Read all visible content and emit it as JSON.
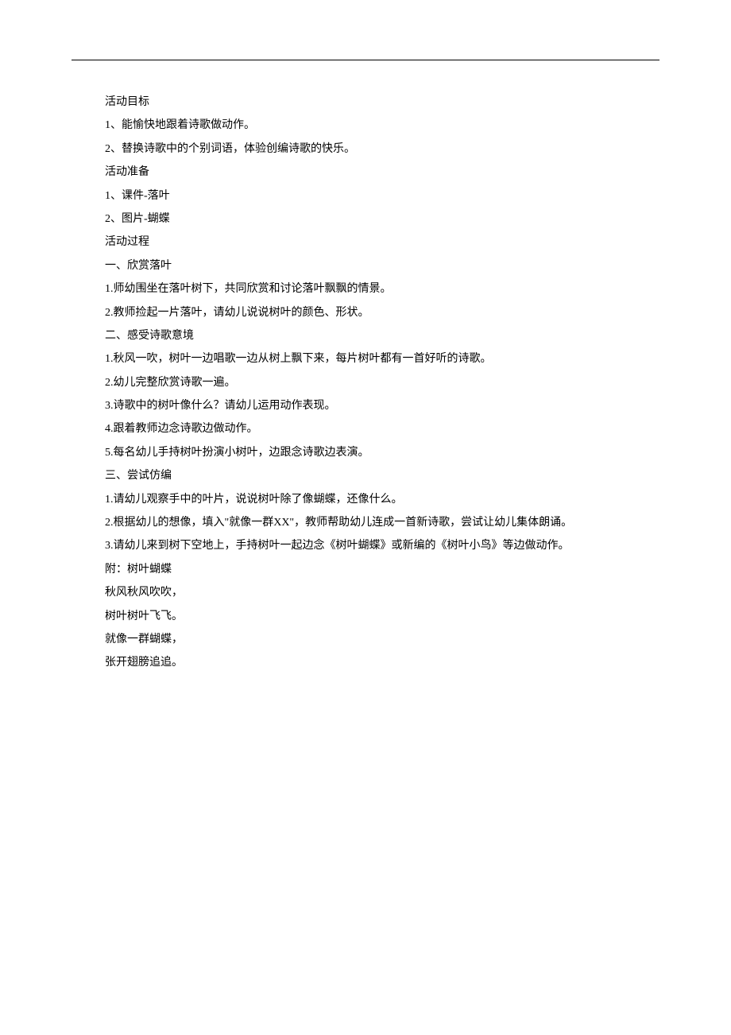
{
  "sections": {
    "goals_heading": "活动目标",
    "goals_items": [
      "1、能愉快地跟着诗歌做动作。",
      "2、替换诗歌中的个别词语，体验创编诗歌的快乐。"
    ],
    "prep_heading": "活动准备",
    "prep_items": [
      "1、课件-落叶",
      "2、图片-蝴蝶"
    ],
    "process_heading": "活动过程",
    "process_parts": {
      "part1_heading": "一、欣赏落叶",
      "part1_items": [
        "1.师幼围坐在落叶树下，共同欣赏和讨论落叶飘飘的情景。",
        "2.教师捡起一片落叶，请幼儿说说树叶的颜色、形状。"
      ],
      "part2_heading": "二、感受诗歌意境",
      "part2_items": [
        "1.秋风一吹，树叶一边唱歌一边从树上飘下来，每片树叶都有一首好听的诗歌。",
        "2.幼儿完整欣赏诗歌一遍。",
        "3.诗歌中的树叶像什么？请幼儿运用动作表现。",
        "4.跟着教师边念诗歌边做动作。",
        "5.每名幼儿手持树叶扮演小树叶，边跟念诗歌边表演。"
      ],
      "part3_heading": "三、尝试仿编",
      "part3_items": [
        "1.请幼儿观察手中的叶片，说说树叶除了像蝴蝶，还像什么。",
        "2.根据幼儿的想像，填入\"就像一群XX\"，教师帮助幼儿连成一首新诗歌，尝试让幼儿集体朗诵。",
        "3.请幼儿来到树下空地上，手持树叶一起边念《树叶蝴蝶》或新编的《树叶小鸟》等边做动作。"
      ]
    },
    "appendix_heading": "附：树叶蝴蝶",
    "poem_lines": [
      "秋风秋风吹吹，",
      "树叶树叶飞飞。",
      "就像一群蝴蝶，",
      "张开翅膀追追。"
    ]
  }
}
